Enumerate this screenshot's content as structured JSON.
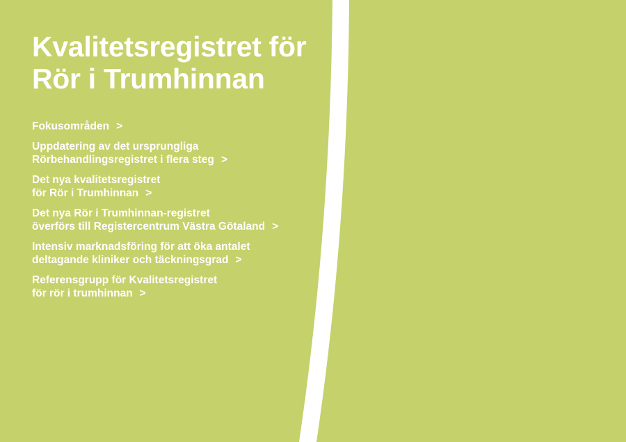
{
  "title": {
    "line1": "Kvalitetsregistret för",
    "line2": "Rör i Trumhinnan"
  },
  "links": [
    {
      "lines": [
        "Fokusområden"
      ],
      "chevron": ">"
    },
    {
      "lines": [
        "Uppdatering av det ursprungliga",
        "Rörbehandlingsregistret i flera steg"
      ],
      "chevron": ">"
    },
    {
      "lines": [
        "Det nya kvalitetsregistret",
        "för Rör i Trumhinnan"
      ],
      "chevron": ">"
    },
    {
      "lines": [
        "Det nya Rör i Trumhinnan-registret",
        "överförs till Registercentrum Västra Götaland"
      ],
      "chevron": ">"
    },
    {
      "lines": [
        "Intensiv marknadsföring för att öka antalet",
        "deltagande kliniker och täckningsgrad"
      ],
      "chevron": ">"
    },
    {
      "lines": [
        "Referensgrupp för Kvalitetsregistret",
        "för rör i trumhinnan"
      ],
      "chevron": ">"
    }
  ],
  "colors": {
    "background": "#c5d16a",
    "band": "#ffffff",
    "text": "#ffffff"
  }
}
